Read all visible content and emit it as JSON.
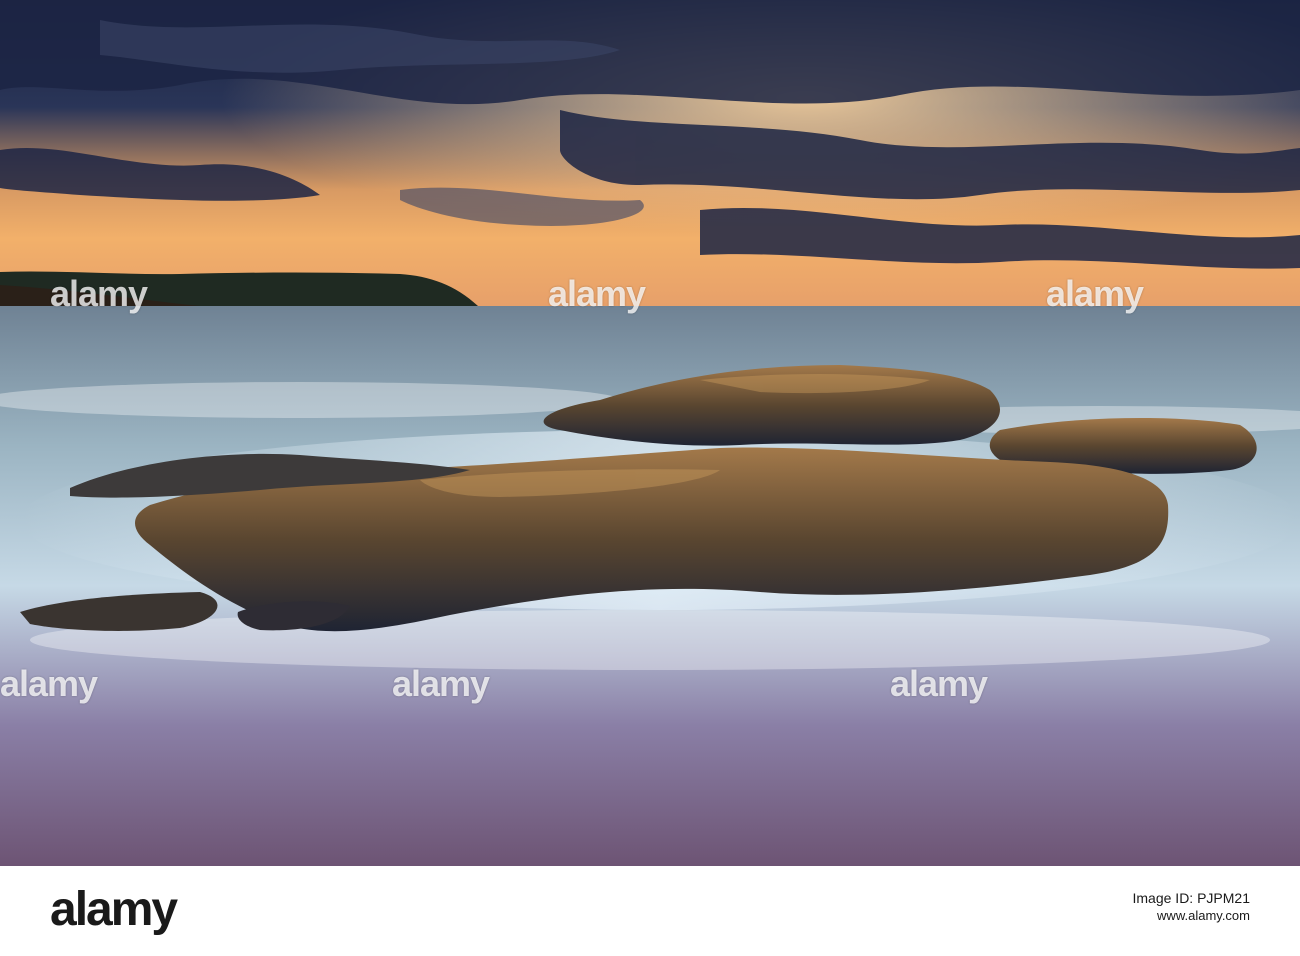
{
  "photo": {
    "subject": "",
    "watermark_text": "alamy",
    "colors": {
      "sky_dark": "#1e2a4a",
      "sky_glow": "#f0a860",
      "sea": "#9fb8c8",
      "rock": "#6a5030",
      "sand": "#7a5a70"
    }
  },
  "footer": {
    "logo_text": "alamy",
    "image_id_label": "Image ID: PJPM21",
    "url": "www.alamy.com"
  }
}
